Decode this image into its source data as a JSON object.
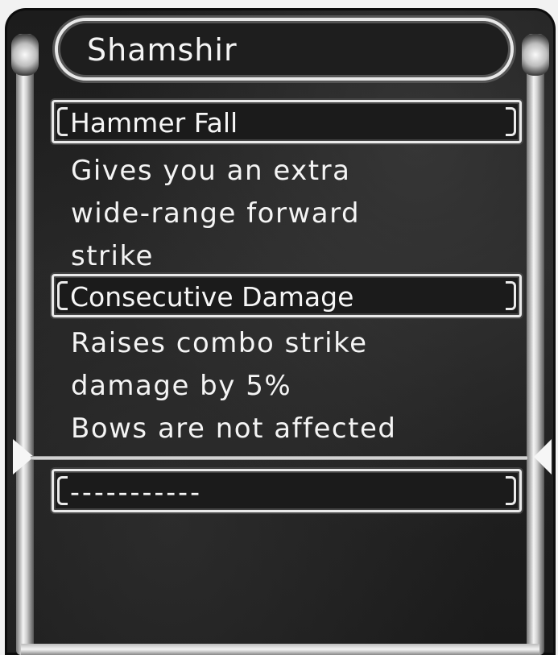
{
  "item": {
    "name": "Shamshir"
  },
  "skills": [
    {
      "name": "Hammer Fall",
      "description": [
        "Gives you an extra",
        "wide-range forward",
        "strike"
      ]
    },
    {
      "name": "Consecutive Damage",
      "description": [
        "Raises combo strike",
        "damage by 5%",
        "Bows are not affected"
      ]
    },
    {
      "name": "-----------"
    }
  ],
  "colors": {
    "text": "#f4f4f4",
    "frame": "#eaeaea",
    "background": "#1e1e1e"
  }
}
